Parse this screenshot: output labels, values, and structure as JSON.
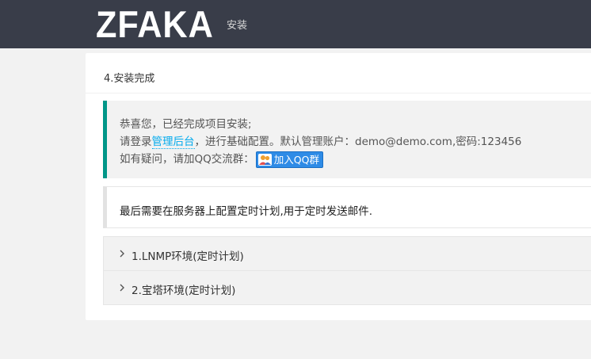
{
  "header": {
    "logo": "ZFAKA",
    "nav": [
      {
        "label": "安装"
      }
    ]
  },
  "card": {
    "title": "4.安装完成",
    "success": {
      "line1": "恭喜您，已经完成项目安装;",
      "line2_prefix": "请登录",
      "line2_link": "管理后台",
      "line2_suffix": "，进行基础配置。默认管理账户：demo@demo.com,密码:123456",
      "line3_prefix": "如有疑问，请加QQ交流群：",
      "qq_button": "加入QQ群"
    },
    "note": "最后需要在服务器上配置定时计划,用于定时发送邮件.",
    "collapse": [
      {
        "label": "1.LNMP环境(定时计划)"
      },
      {
        "label": "2.宝塔环境(定时计划)"
      }
    ]
  },
  "colors": {
    "topbar": "#393d49",
    "accent": "#009688",
    "link": "#01AAED",
    "qq_button": "#2e8be6"
  },
  "icons": {
    "qq": "qq-group-icon",
    "chevron": "chevron-right-icon"
  }
}
